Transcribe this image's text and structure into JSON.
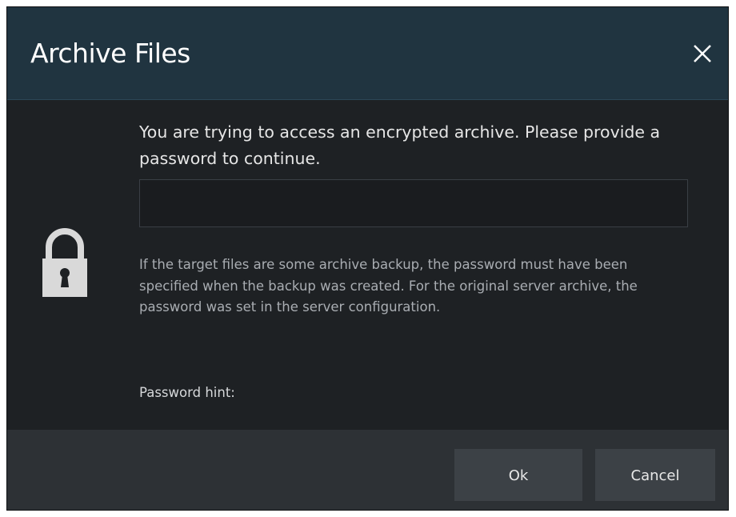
{
  "dialog": {
    "title": "Archive Files",
    "close_icon": "close-icon",
    "lock_icon": "padlock-icon",
    "prompt": "You are trying to access an encrypted archive. Please provide a password to continue.",
    "password_value": "",
    "info": "If the target files are some archive backup, the password must have been specified when the backup was created. For the original server archive, the password was set in the server configuration.",
    "hint_label": "Password hint:",
    "ok_label": "Ok",
    "cancel_label": "Cancel"
  },
  "colors": {
    "titlebar": "#203440",
    "body": "#1e2124",
    "footer": "#2d3135",
    "button": "#3c4146",
    "lock": "#d9d9d9"
  }
}
